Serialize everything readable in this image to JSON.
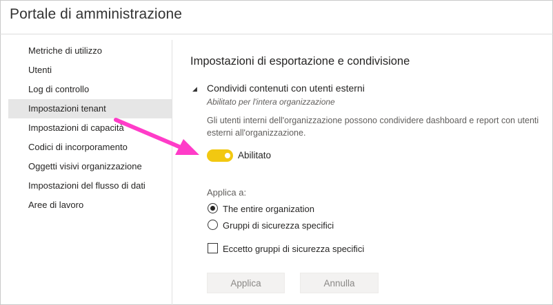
{
  "header": {
    "title": "Portale di amministrazione"
  },
  "sidebar": {
    "items": [
      {
        "label": "Metriche di utilizzo",
        "selected": false
      },
      {
        "label": "Utenti",
        "selected": false
      },
      {
        "label": "Log di controllo",
        "selected": false
      },
      {
        "label": "Impostazioni tenant",
        "selected": true
      },
      {
        "label": "Impostazioni di capacità",
        "selected": false
      },
      {
        "label": "Codici di incorporamento",
        "selected": false
      },
      {
        "label": "Oggetti visivi organizzazione",
        "selected": false
      },
      {
        "label": "Impostazioni del flusso di dati",
        "selected": false
      },
      {
        "label": "Aree di lavoro",
        "selected": false
      }
    ]
  },
  "main": {
    "section_title": "Impostazioni di esportazione e condivisione",
    "setting": {
      "collapse_icon": "triangle-down-icon",
      "title": "Condividi contenuti con utenti esterni",
      "status": "Abilitato per l'intera organizzazione",
      "description": "Gli utenti interni dell'organizzazione possono condividere dashboard e report con utenti esterni all'organizzazione.",
      "toggle_label": "Abilitato",
      "toggle_on": true,
      "apply_to_label": "Applica a:",
      "options": [
        {
          "label": "The entire organization",
          "checked": true
        },
        {
          "label": "Gruppi di sicurezza specifici",
          "checked": false
        }
      ],
      "except_label": "Eccetto gruppi di sicurezza specifici",
      "except_checked": false
    },
    "buttons": {
      "apply": "Applica",
      "cancel": "Annulla"
    }
  },
  "colors": {
    "toggle_on": "#f2c811",
    "annotation_arrow": "#ff3cc8",
    "selected_nav_bg": "#e6e6e6"
  }
}
